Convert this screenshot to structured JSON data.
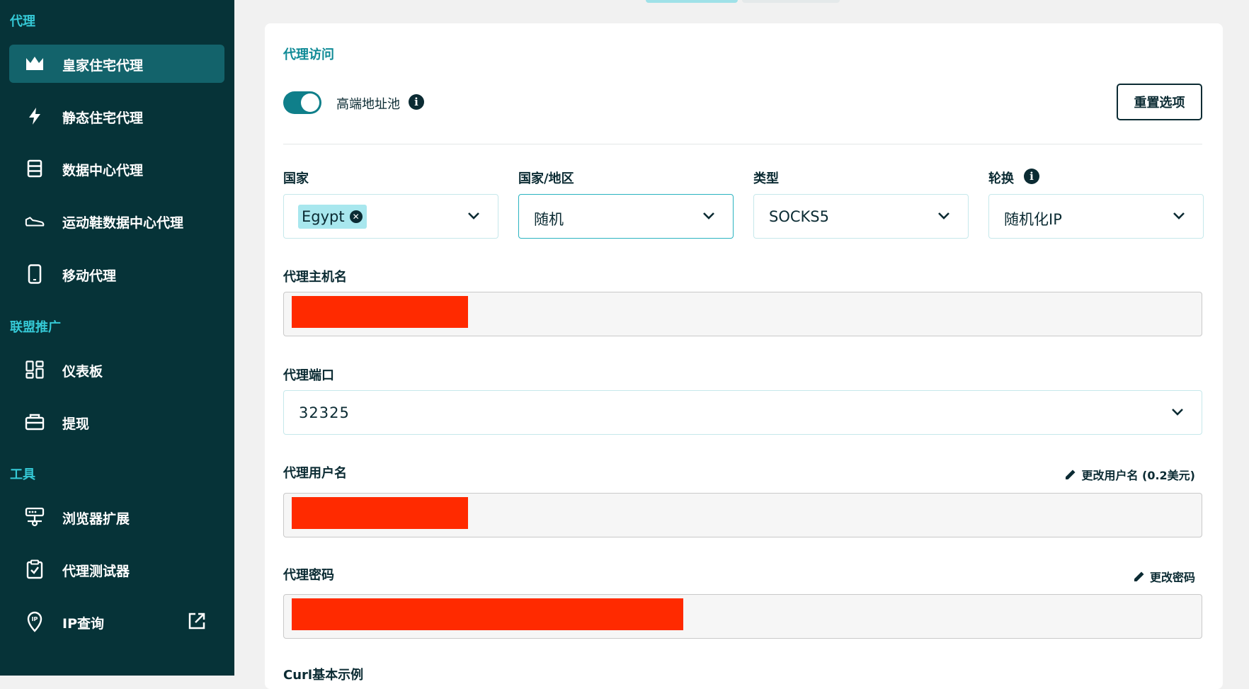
{
  "sidebar": {
    "sections": [
      {
        "title": "代理"
      },
      {
        "title": "联盟推广"
      },
      {
        "title": "工具"
      }
    ],
    "items": [
      {
        "label": "皇家住宅代理",
        "icon": "crown-icon"
      },
      {
        "label": "静态住宅代理",
        "icon": "lightning-icon"
      },
      {
        "label": "数据中心代理",
        "icon": "server-icon"
      },
      {
        "label": "运动鞋数据中心代理",
        "icon": "sneaker-icon"
      },
      {
        "label": "移动代理",
        "icon": "mobile-icon"
      },
      {
        "label": "仪表板",
        "icon": "dashboard-icon"
      },
      {
        "label": "提现",
        "icon": "wallet-icon"
      },
      {
        "label": "浏览器扩展",
        "icon": "extension-icon"
      },
      {
        "label": "代理测试器",
        "icon": "clipboard-check-icon"
      },
      {
        "label": "IP查询",
        "icon": "location-ip-icon",
        "external": "external-link-icon"
      }
    ]
  },
  "main": {
    "section_title": "代理访问",
    "premium_pool": {
      "label": "高端地址池",
      "enabled": true
    },
    "reset_button": "重置选项",
    "filters": {
      "country": {
        "label": "国家",
        "chip": "Egypt"
      },
      "region": {
        "label": "国家/地区",
        "value": "随机"
      },
      "type": {
        "label": "类型",
        "value": "SOCKS5"
      },
      "rotation": {
        "label": "轮换",
        "value": "随机化IP"
      }
    },
    "hostname": {
      "label": "代理主机名"
    },
    "port": {
      "label": "代理端口",
      "value": "32325"
    },
    "username": {
      "label": "代理用户名",
      "edit": "更改用户名 (0.2美元)"
    },
    "password": {
      "label": "代理密码",
      "edit": "更改密码"
    },
    "curl": {
      "label": "Curl基本示例"
    }
  },
  "colors": {
    "sidebar_bg": "#063338",
    "accent": "#0f7f8a",
    "section_accent": "#35c9d6",
    "redaction": "#ff2a00"
  }
}
